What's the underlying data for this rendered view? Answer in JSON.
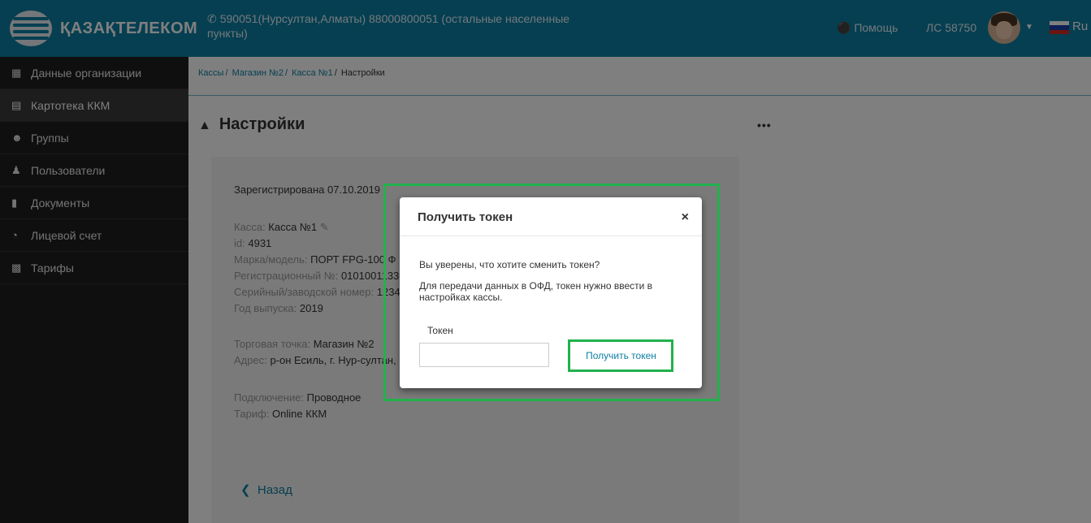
{
  "header": {
    "brand": "ҚАЗАҚТЕЛЕКОМ",
    "phone_icon": "phone-icon",
    "phone": "590051(Нурсултан,Алматы) 88000800051 (остальные населенные пункты)",
    "help": "Помощь",
    "account": "ЛС 58750",
    "lang": "Ru",
    "colors": {
      "bar": "#0d7fa3"
    }
  },
  "sidebar": {
    "items": [
      {
        "label": "Данные организации",
        "icon": "building-icon"
      },
      {
        "label": "Картотека ККМ",
        "icon": "register-icon",
        "active": true
      },
      {
        "label": "Группы",
        "icon": "group-icon"
      },
      {
        "label": "Пользователи",
        "icon": "user-icon"
      },
      {
        "label": "Документы",
        "icon": "document-icon"
      },
      {
        "label": "Лицевой счет",
        "icon": "account-icon"
      },
      {
        "label": "Тарифы",
        "icon": "tariff-icon"
      }
    ]
  },
  "breadcrumb": {
    "c1": "Кассы",
    "c2": "Магазин №2",
    "c3": "Касса №1",
    "current": "Настройки"
  },
  "page": {
    "title": "Настройки",
    "more": "•••",
    "registered": "Зарегистрирована 07.10.2019",
    "kassa_label": "Касса:",
    "kassa_value": "Касса №1",
    "id_label": "id:",
    "id_value": "4931",
    "model_label": "Марка/модель:",
    "model_value": "ПОРТ FPG-100 Ф",
    "reg_label": "Регистрационный №:",
    "reg_value": "01010011330",
    "serial_label": "Серийный/заводской номер:",
    "serial_value": "1234",
    "year_label": "Год выпуска:",
    "year_value": "2019",
    "shop_label": "Торговая точка:",
    "shop_value": "Магазин №2",
    "addr_label": "Адрес:",
    "addr_value": "р-он Есиль, г. Нур-султан, С",
    "conn_label": "Подключение:",
    "conn_value": "Проводное",
    "tariff_label": "Тариф:",
    "tariff_value": "Online ККМ",
    "back": "Назад"
  },
  "modal": {
    "title": "Получить токен",
    "close": "×",
    "question": "Вы уверены, что хотите сменить токен?",
    "description": "Для передачи данных в ОФД, токен нужно ввести в настройках кассы.",
    "token_label": "Токен",
    "token_value": "",
    "button": "Получить токен"
  },
  "highlight_color": "#22b14c"
}
